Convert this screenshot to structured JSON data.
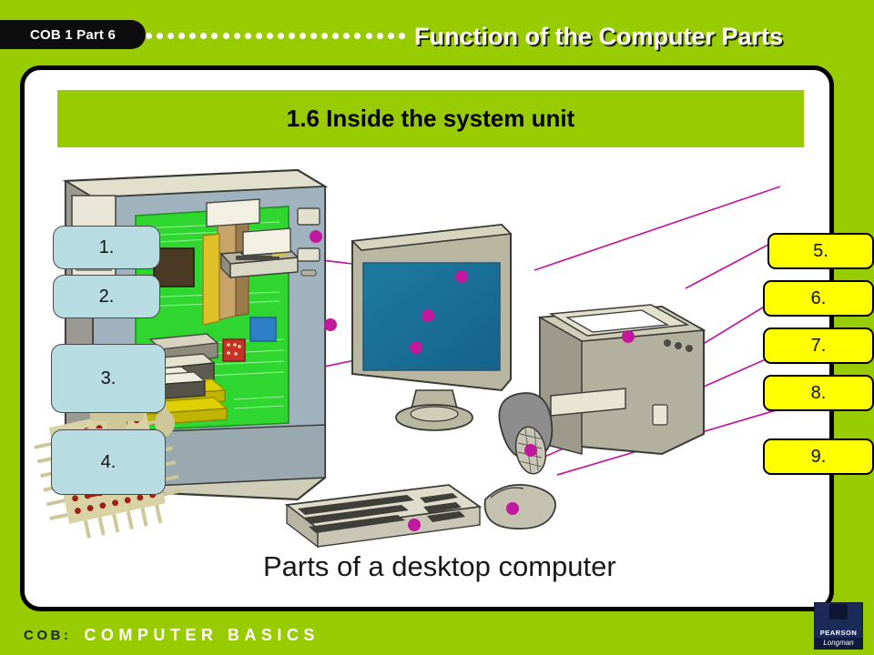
{
  "header": {
    "badge_label": "COB 1 Part 6",
    "title": "Function of the Computer Parts",
    "dot_count": 24,
    "background_color": "#99cc00",
    "badge_color": "#0d0d0d"
  },
  "panel": {
    "subtitle": "1.6 Inside the system unit",
    "caption": "Parts of a desktop computer",
    "background_color": "#ffffff",
    "border_color": "#000000",
    "subtitle_bar_color": "#99cc00"
  },
  "answer_boxes": {
    "left_color": "#b7dce1",
    "right_color": "#ffff00",
    "left": [
      {
        "label": "1."
      },
      {
        "label": "2."
      },
      {
        "label": "3."
      },
      {
        "label": "4."
      }
    ],
    "right": [
      {
        "label": "5."
      },
      {
        "label": "6."
      },
      {
        "label": "7."
      },
      {
        "label": "8."
      },
      {
        "label": "9."
      }
    ]
  },
  "illustration": {
    "callout_color": "#c2189e",
    "parts": [
      "system-unit-cutaway",
      "motherboard",
      "cpu-socket",
      "disk-drives",
      "expansion-cards",
      "monitor",
      "printer",
      "speaker",
      "mouse",
      "keyboard"
    ]
  },
  "footer": {
    "prefix": "COB:",
    "title": "COMPUTER BASICS",
    "background_color": "#99cc00",
    "logo": {
      "brand": "PEARSON",
      "imprint": "Longman"
    }
  }
}
